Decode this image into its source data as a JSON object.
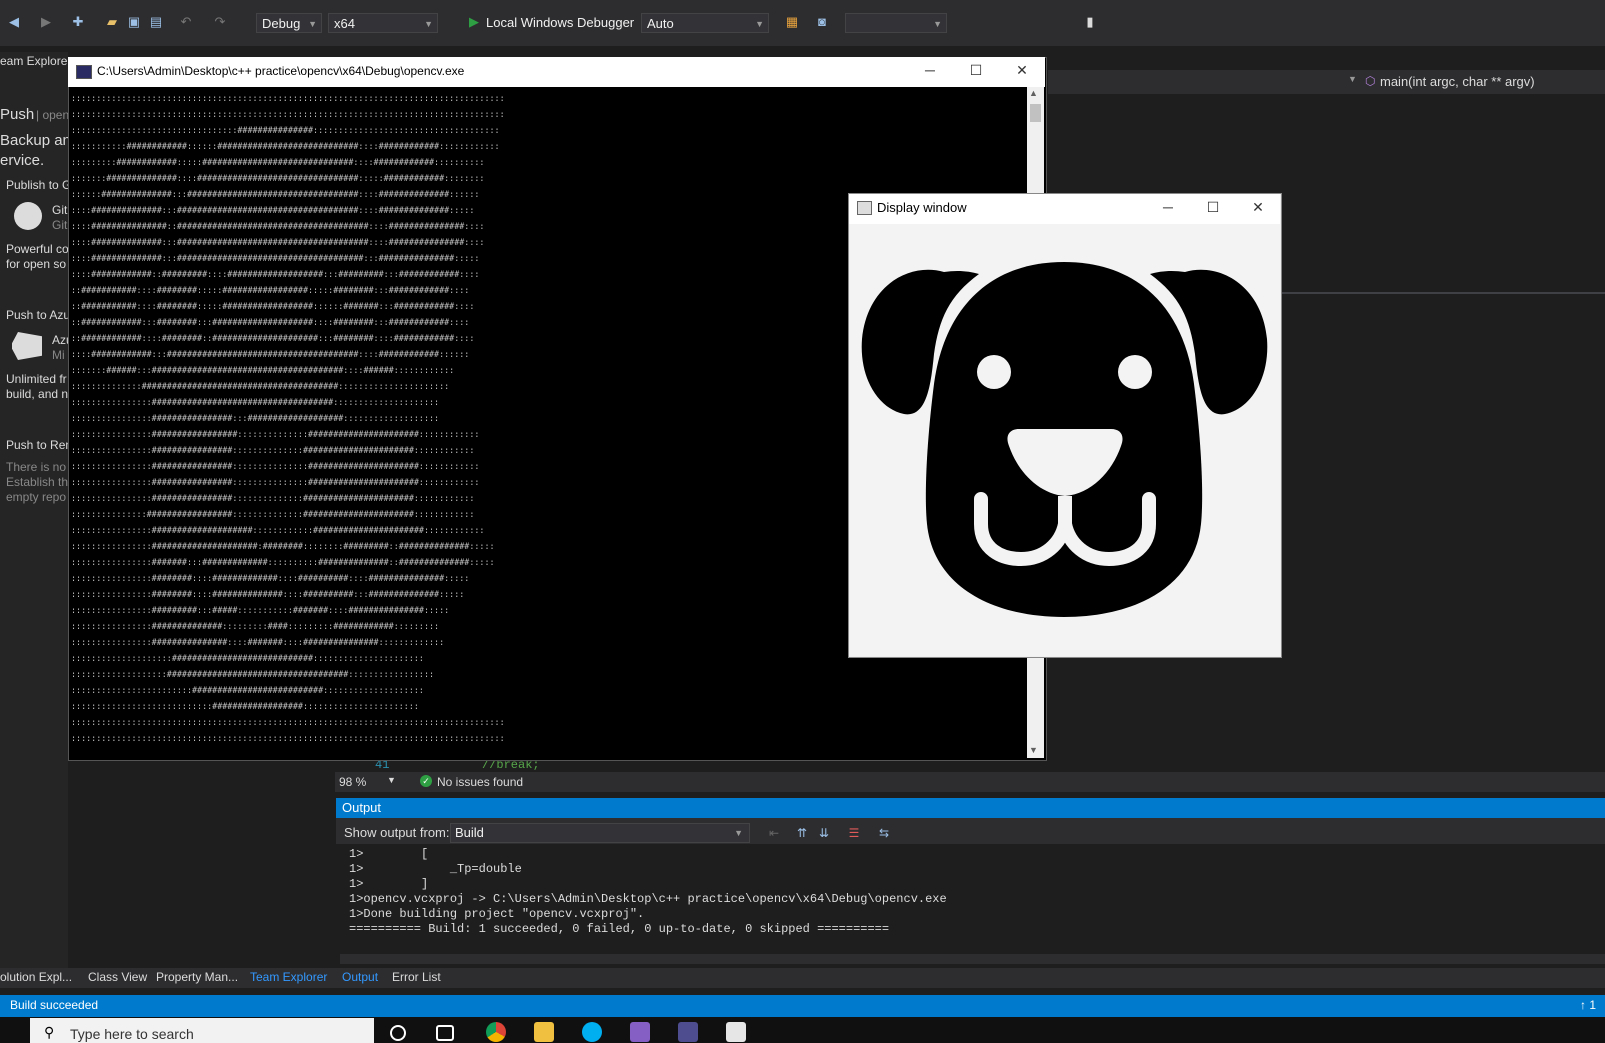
{
  "toolbar": {
    "config": "Debug",
    "platform": "x64",
    "debugger": "Local Windows Debugger",
    "solution_config": "Auto",
    "icons": [
      "back-icon",
      "forward-icon",
      "new-project-icon",
      "open-icon",
      "save-icon",
      "save-all-icon",
      "undo-icon",
      "redo-icon",
      "start-icon",
      "browser-icon",
      "camera-icon",
      "bookmark-icon"
    ]
  },
  "editor": {
    "nav_function": "main(int argc, char ** argv)",
    "line_number": "41",
    "code_line": "//break;",
    "zoom": "98 %",
    "issues": "No issues found"
  },
  "team_explorer": {
    "title": "eam Explorer",
    "push": "Push",
    "push_repo": "| openc",
    "backup_line1": "Backup an",
    "backup_line2": "ervice.",
    "publish_github": "Publish to G",
    "github_label": "Git",
    "github_sub": "Git",
    "powerful_line1": "Powerful co",
    "powerful_line2": "for open so",
    "push_azure": "Push to Azu",
    "azure_label": "Azu",
    "azure_sub": "Mi",
    "unlimited_line1": "Unlimited fr",
    "unlimited_line2": "build, and n",
    "push_remote": "Push to Rem",
    "remote_line1": "There is no",
    "remote_line2": "Establish th",
    "remote_line3": "empty repo"
  },
  "output": {
    "title": "Output",
    "show_output_label": "Show output from:",
    "source": "Build",
    "lines": [
      "1>        [",
      "1>            _Tp=double",
      "1>        ]",
      "1>opencv.vcxproj -> C:\\Users\\Admin\\Desktop\\c++ practice\\opencv\\x64\\Debug\\opencv.exe",
      "1>Done building project \"opencv.vcxproj\".",
      "========== Build: 1 succeeded, 0 failed, 0 up-to-date, 0 skipped =========="
    ]
  },
  "bottom_tabs": {
    "solution_explorer": "olution Expl...",
    "class_view": "Class View",
    "property_manager": "Property Man...",
    "team_explorer": "Team Explorer",
    "output": "Output",
    "error_list": "Error List"
  },
  "status": {
    "text": "Build succeeded",
    "count": "1"
  },
  "taskbar": {
    "search_placeholder": "Type here to search"
  },
  "console": {
    "title": "C:\\Users\\Admin\\Desktop\\c++ practice\\opencv\\x64\\Debug\\opencv.exe",
    "ascii_art": [
      "::::::::::::::::::::::::::::::::::::::::::::::::::::::::::::::::::::::::::::::::::::::",
      "::::::::::::::::::::::::::::::::::::::::::::::::::::::::::::::::::::::::::::::::::::::",
      ":::::::::::::::::::::::::::::::::###############:::::::::::::::::::::::::::::::::::::",
      ":::::::::::############::::::############################::::############::::::::::::",
      ":::::::::############:::::##############################::::############::::::::::",
      ":::::::##############::::################################:::::############::::::::",
      "::::::##############:::##################################::::##############::::::",
      "::::##############:::####################################::::##############:::::",
      "::::###############::######################################::::###############::::",
      "::::##############:::######################################::::###############::::",
      "::::##############:::#####################################:::###############:::::",
      "::::############::#########::::###################:::#########:::############::::",
      "::###########::::########:::::#################:::::########:::############::::",
      "::###########::::########:::::##################::::::#######:::############::::",
      "::############:::########:::####################::::########:::############::::",
      "::############::::########::#####################:::########::::############::::",
      "::::############:::######################################::::############::::::",
      ":::::::######:::######################################::::######::::::::::::",
      "::::::::::::::#######################################::::::::::::::::::::::",
      "::::::::::::::::####################################:::::::::::::::::::::",
      "::::::::::::::::################:::###################:::::::::::::::::::",
      "::::::::::::::::#################::::::::::::::######################::::::::::::",
      "::::::::::::::::################::::::::::::::######################::::::::::::",
      "::::::::::::::::################:::::::::::::::######################::::::::::::",
      "::::::::::::::::################:::::::::::::::######################::::::::::::",
      "::::::::::::::::################::::::::::::::######################::::::::::::",
      ":::::::::::::::#################::::::::::::::######################::::::::::::",
      "::::::::::::::::####################::::::::::::######################::::::::::::",
      "::::::::::::::::#####################:########::::::::#########::##############:::::",
      "::::::::::::::::#######:::#############::::::::::##############::##############:::::",
      "::::::::::::::::########::::#############::::##########::::###############:::::",
      "::::::::::::::::########::::##############::::##########:::##############:::::",
      "::::::::::::::::#########:::#####:::::::::::#######::::###############:::::",
      "::::::::::::::::##############:::::::::####:::::::::############:::::::::",
      "::::::::::::::::###############::::#######::::###############:::::::::::::",
      "::::::::::::::::::::############################::::::::::::::::::::::",
      ":::::::::::::::::::####################################:::::::::::::::::",
      "::::::::::::::::::::::::##########################::::::::::::::::::::",
      "::::::::::::::::::::::::::::##################:::::::::::::::::::::::",
      "::::::::::::::::::::::::::::::::::::::::::::::::::::::::::::::::::::::::::::::::::::::",
      "::::::::::::::::::::::::::::::::::::::::::::::::::::::::::::::::::::::::::::::::::::::"
    ]
  },
  "display": {
    "title": "Display window"
  },
  "colors": {
    "accent": "#007acc",
    "ide_bg": "#1e1e1e",
    "success": "#2ea043"
  }
}
